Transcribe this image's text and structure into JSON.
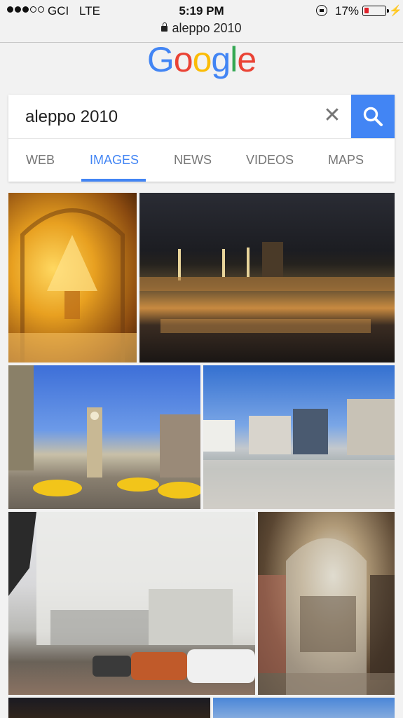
{
  "status_bar": {
    "carrier": "GCI",
    "network": "LTE",
    "time": "5:19 PM",
    "battery": "17%"
  },
  "browser": {
    "url": "aleppo 2010"
  },
  "logo": {
    "letters": [
      "G",
      "o",
      "o",
      "g",
      "l",
      "e"
    ]
  },
  "search": {
    "query": "aleppo 2010",
    "clear_icon": "✕"
  },
  "tabs": [
    {
      "label": "WEB",
      "active": false
    },
    {
      "label": "IMAGES",
      "active": true
    },
    {
      "label": "NEWS",
      "active": false
    },
    {
      "label": "VIDEOS",
      "active": false
    },
    {
      "label": "MAPS",
      "active": false
    }
  ],
  "colors": {
    "accent": "#4285f4",
    "battery_low": "#e0222b"
  },
  "results": [
    {
      "subject": "lit covered souk interior with lantern"
    },
    {
      "subject": "city skyline at night"
    },
    {
      "subject": "clock tower street with yellow taxis"
    },
    {
      "subject": "public square with modern buildings"
    },
    {
      "subject": "white stone corner building with parked cars"
    },
    {
      "subject": "vaulted market passage with shoppers"
    },
    {
      "subject": "dark image with lit dome"
    },
    {
      "subject": "buildings under blue sky"
    }
  ]
}
